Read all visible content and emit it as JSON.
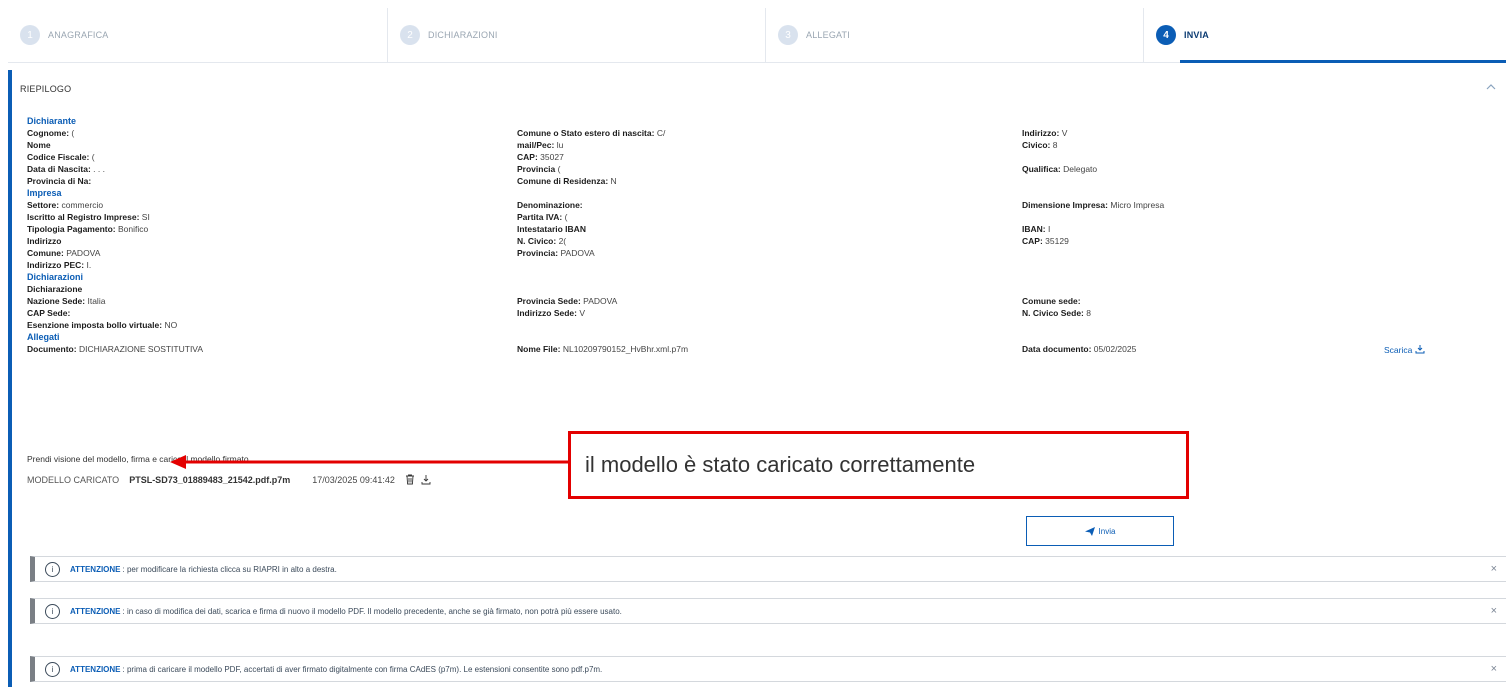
{
  "steps": [
    {
      "num": "1",
      "label": "ANAGRAFICA"
    },
    {
      "num": "2",
      "label": "DICHIARAZIONI"
    },
    {
      "num": "3",
      "label": "ALLEGATI"
    },
    {
      "num": "4",
      "label": "INVIA"
    }
  ],
  "panel": {
    "title": "RIEPILOGO",
    "sections": {
      "dichiarante": "Dichiarante",
      "impresa": "Impresa",
      "dichiarazioni": "Dichiarazioni",
      "allegati": "Allegati"
    },
    "dichiarante": {
      "cognome": {
        "label": "Cognome:",
        "value": "("
      },
      "nome": {
        "label": "Nome",
        "value": ""
      },
      "codice_fiscale": {
        "label": "Codice Fiscale:",
        "value": "("
      },
      "data_nascita": {
        "label": "Data di Nascita:",
        "value": ". . ."
      },
      "provincia_nascita": {
        "label": "Provincia di Na:",
        "value": ""
      },
      "comune_estero": {
        "label": "Comune o Stato estero di nascita:",
        "value": "C/"
      },
      "mail": {
        "label": "mail/Pec:",
        "value": "lu"
      },
      "cap": {
        "label": "CAP:",
        "value": "35027"
      },
      "provincia": {
        "label": "Provincia",
        "value": "("
      },
      "comune_residenza": {
        "label": "Comune di Residenza:",
        "value": "N"
      },
      "indirizzo": {
        "label": "Indirizzo:",
        "value": "V"
      },
      "civico": {
        "label": "Civico:",
        "value": "8"
      },
      "qualifica": {
        "label": "Qualifica:",
        "value": "Delegato"
      }
    },
    "impresa": {
      "settore": {
        "label": "Settore:",
        "value": "commercio"
      },
      "iscritto": {
        "label": "Iscritto al Registro Imprese:",
        "value": "SI"
      },
      "tipologia": {
        "label": "Tipologia Pagamento:",
        "value": "Bonifico"
      },
      "indirizzo": {
        "label": "Indirizzo",
        "value": ""
      },
      "comune": {
        "label": "Comune:",
        "value": "PADOVA"
      },
      "pec": {
        "label": "Indirizzo PEC:",
        "value": "I."
      },
      "denominazione": {
        "label": "Denominazione:",
        "value": ""
      },
      "partita_iva": {
        "label": "Partita IVA:",
        "value": "("
      },
      "intestatario": {
        "label": "Intestatario IBAN",
        "value": ""
      },
      "n_civico": {
        "label": "N. Civico:",
        "value": "2("
      },
      "provincia": {
        "label": "Provincia:",
        "value": "PADOVA"
      },
      "dimensione": {
        "label": "Dimensione Impresa:",
        "value": "Micro Impresa"
      },
      "iban": {
        "label": "IBAN:",
        "value": "I"
      },
      "cap": {
        "label": "CAP:",
        "value": "35129"
      }
    },
    "dichiarazioni": {
      "titolo": "Dichiarazione",
      "nazione": {
        "label": "Nazione Sede:",
        "value": "Italia"
      },
      "cap_sede": {
        "label": "CAP Sede:",
        "value": ""
      },
      "esenzione": {
        "label": "Esenzione imposta bollo virtuale:",
        "value": "NO"
      },
      "provincia_sede": {
        "label": "Provincia Sede:",
        "value": "PADOVA"
      },
      "indirizzo_sede": {
        "label": "Indirizzo Sede:",
        "value": "V"
      },
      "comune_sede": {
        "label": "Comune sede:",
        "value": ""
      },
      "civico_sede": {
        "label": "N. Civico Sede:",
        "value": "8"
      }
    },
    "allegati": {
      "documento": {
        "label": "Documento:",
        "value": "DICHIARAZIONE SOSTITUTIVA"
      },
      "nome_file": {
        "label": "Nome File:",
        "value": "NL10209790152_HvBhr.xml.p7m"
      },
      "data_doc": {
        "label": "Data documento:",
        "value": "05/02/2025"
      },
      "scarica": "Scarica"
    },
    "visione": "Prendi visione del modello, firma e carica il modello firmato",
    "modello": {
      "label": "MODELLO CARICATO",
      "filename": "PTSL-SD73_01889483_21542.pdf.p7m",
      "datetime": "17/03/2025 09:41:42"
    },
    "invia_label": "Invia"
  },
  "alerts": [
    {
      "strong": "ATTENZIONE",
      "text": ": per modificare la richiesta clicca su RIAPRI in alto a destra."
    },
    {
      "strong": "ATTENZIONE",
      "text": ": in caso di modifica dei dati, scarica e firma di nuovo il modello PDF. Il modello precedente, anche se già firmato, non potrà più essere usato."
    },
    {
      "strong": "ATTENZIONE",
      "text": ": prima di caricare il modello PDF, accertati di aver firmato digitalmente con firma CAdES (p7m). Le estensioni consentite sono pdf.p7m."
    }
  ],
  "annotation": "il modello è stato caricato correttamente",
  "colors": {
    "accent": "#0b5db5",
    "annotation": "#e30000"
  }
}
